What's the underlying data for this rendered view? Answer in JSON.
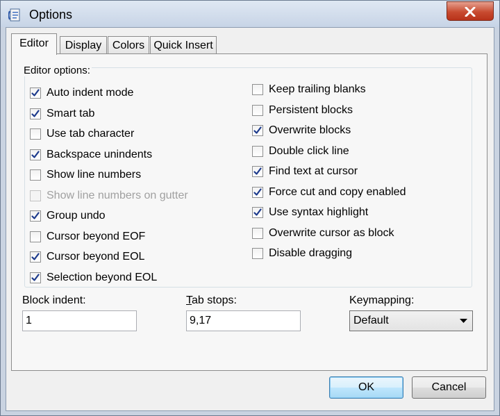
{
  "window": {
    "title": "Options"
  },
  "tabs": [
    {
      "label": "Editor",
      "active": true
    },
    {
      "label": "Display",
      "active": false
    },
    {
      "label": "Colors",
      "active": false
    },
    {
      "label": "Quick Insert",
      "active": false
    }
  ],
  "editor_options": {
    "group_label": "Editor options:",
    "left_column": [
      {
        "label": "Auto indent mode",
        "checked": true,
        "enabled": true
      },
      {
        "label": "Smart tab",
        "checked": true,
        "enabled": true
      },
      {
        "label": "Use tab character",
        "checked": false,
        "enabled": true
      },
      {
        "label": "Backspace unindents",
        "checked": true,
        "enabled": true
      },
      {
        "label": "Show line numbers",
        "checked": false,
        "enabled": true
      },
      {
        "label": "Show line numbers on gutter",
        "checked": false,
        "enabled": false
      },
      {
        "label": "Group undo",
        "checked": true,
        "enabled": true
      },
      {
        "label": "Cursor beyond EOF",
        "checked": false,
        "enabled": true
      },
      {
        "label": "Cursor beyond EOL",
        "checked": true,
        "enabled": true
      },
      {
        "label": "Selection beyond EOL",
        "checked": true,
        "enabled": true
      }
    ],
    "right_column": [
      {
        "label": "Keep trailing blanks",
        "checked": false,
        "enabled": true
      },
      {
        "label": "Persistent blocks",
        "checked": false,
        "enabled": true
      },
      {
        "label": "Overwrite blocks",
        "checked": true,
        "enabled": true
      },
      {
        "label": "Double click line",
        "checked": false,
        "enabled": true
      },
      {
        "label": "Find text at cursor",
        "checked": true,
        "enabled": true
      },
      {
        "label": "Force cut and copy enabled",
        "checked": true,
        "enabled": true
      },
      {
        "label": "Use syntax highlight",
        "checked": true,
        "enabled": true
      },
      {
        "label": "Overwrite cursor as block",
        "checked": false,
        "enabled": true
      },
      {
        "label": "Disable dragging",
        "checked": false,
        "enabled": true
      }
    ]
  },
  "fields": {
    "block_indent": {
      "label": "Block indent:",
      "value": "1"
    },
    "tab_stops": {
      "label_prefix": "T",
      "label_rest": "ab stops:",
      "value": "9,17"
    },
    "keymapping": {
      "label": "Keymapping:",
      "value": "Default"
    }
  },
  "buttons": {
    "ok": "OK",
    "cancel": "Cancel"
  },
  "icons": {
    "app": "options-app-icon",
    "close": "close-icon",
    "check": "check-icon",
    "dropdown": "chevron-down-icon"
  },
  "colors": {
    "close_button": "#c84b30",
    "check_mark": "#1c3a8c",
    "default_button_border": "#3c7fb1"
  }
}
